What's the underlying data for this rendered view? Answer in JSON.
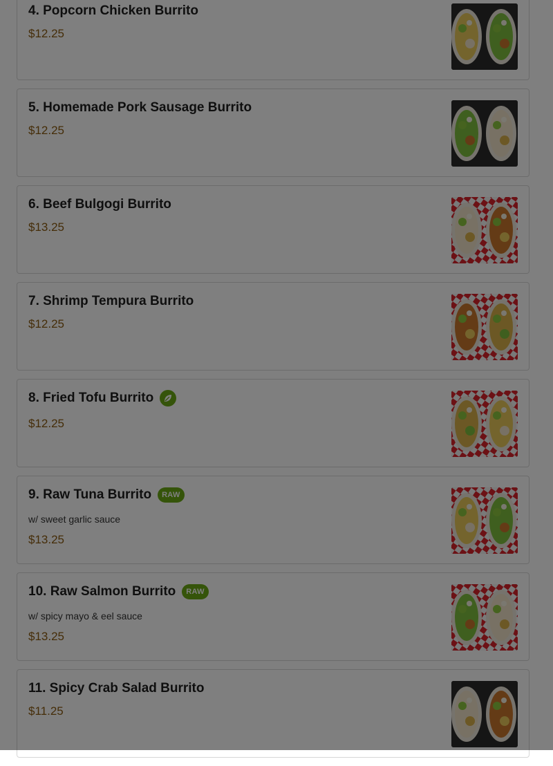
{
  "overlay_color": "#000000",
  "accent_color": "#6aa814",
  "price_color": "#8a5a10",
  "items": [
    {
      "name": "4. Popcorn Chicken Burrito",
      "price": "$12.25",
      "description": "",
      "badge": "",
      "image": "popcorn-chicken-burrito-photo",
      "wrap": "plain"
    },
    {
      "name": "5. Homemade Pork Sausage Burrito",
      "price": "$12.25",
      "description": "",
      "badge": "",
      "image": "pork-sausage-burrito-photo",
      "wrap": "plain"
    },
    {
      "name": "6. Beef Bulgogi Burrito",
      "price": "$13.25",
      "description": "",
      "badge": "",
      "image": "beef-bulgogi-burrito-photo",
      "wrap": "checkered"
    },
    {
      "name": "7. Shrimp Tempura Burrito",
      "price": "$12.25",
      "description": "",
      "badge": "",
      "image": "shrimp-tempura-burrito-photo",
      "wrap": "checkered"
    },
    {
      "name": "8. Fried Tofu Burrito",
      "price": "$12.25",
      "description": "",
      "badge": "leaf-icon",
      "image": "fried-tofu-burrito-photo",
      "wrap": "checkered"
    },
    {
      "name": "9. Raw Tuna Burrito",
      "price": "$13.25",
      "description": "w/ sweet garlic sauce",
      "badge": "RAW",
      "image": "raw-tuna-burrito-photo",
      "wrap": "checkered"
    },
    {
      "name": "10. Raw Salmon Burrito",
      "price": "$13.25",
      "description": "w/ spicy mayo & eel sauce",
      "badge": "RAW",
      "image": "raw-salmon-burrito-photo",
      "wrap": "checkered"
    },
    {
      "name": "11. Spicy Crab Salad Burrito",
      "price": "$11.25",
      "description": "",
      "badge": "",
      "image": "spicy-crab-salad-burrito-photo",
      "wrap": "plain"
    }
  ]
}
